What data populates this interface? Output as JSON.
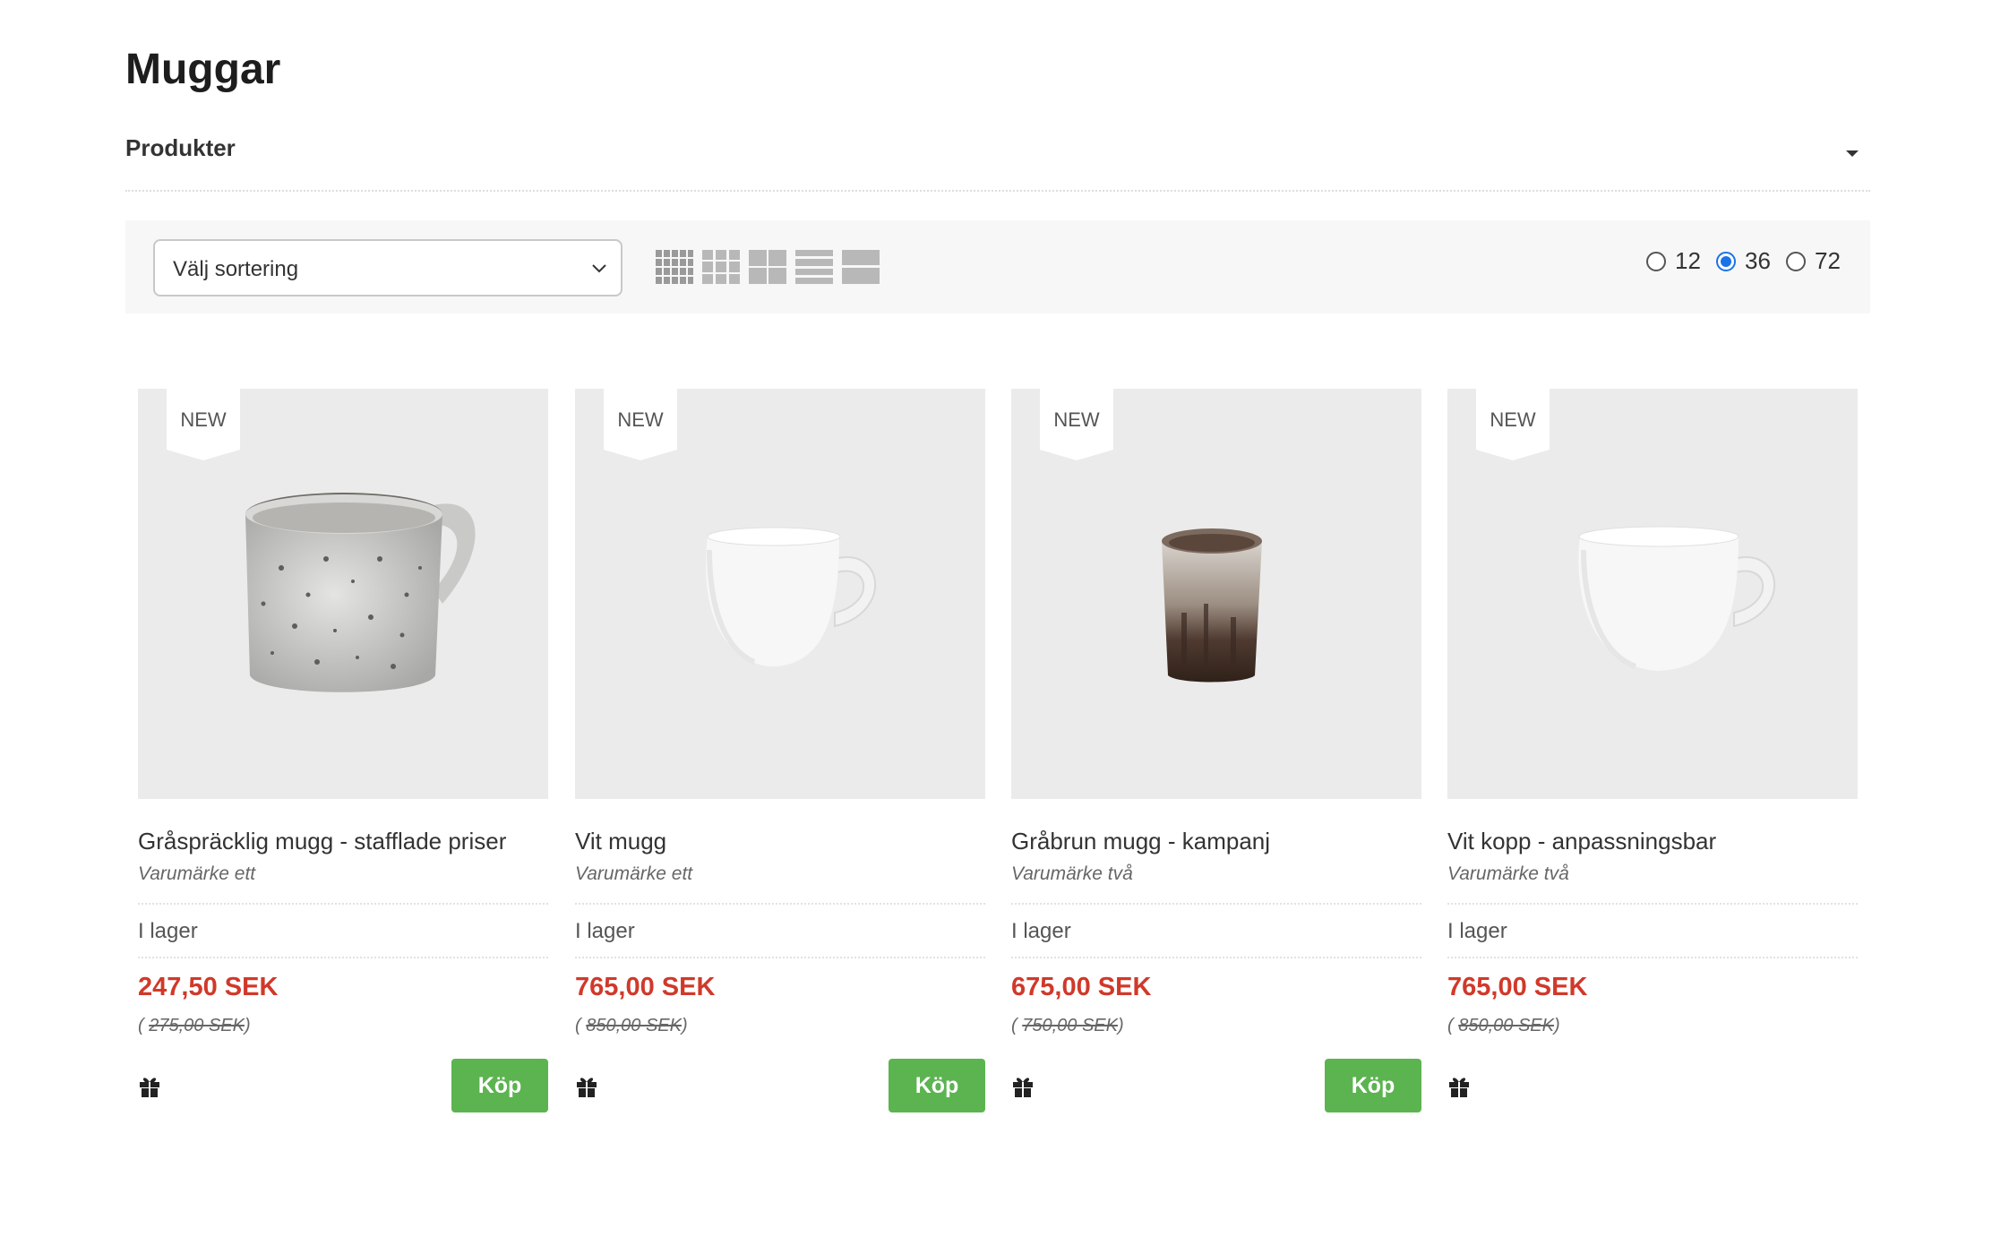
{
  "page": {
    "title": "Muggar"
  },
  "filter": {
    "label": "Produkter"
  },
  "toolbar": {
    "sort_placeholder": "Välj sortering",
    "per_page_options": [
      "12",
      "36",
      "72"
    ],
    "per_page_selected": "36",
    "view_modes": [
      "grid-5-icon",
      "grid-4-icon",
      "grid-3-icon",
      "list-icon",
      "list-large-icon"
    ]
  },
  "products": [
    {
      "badge": "NEW",
      "name": "Gråspräcklig mugg - stafflade priser",
      "brand": "Varumärke ett",
      "stock": "I lager",
      "price": "247,50 SEK",
      "old_price": "275,00 SEK",
      "buy_label": "Köp"
    },
    {
      "badge": "NEW",
      "name": "Vit mugg",
      "brand": "Varumärke ett",
      "stock": "I lager",
      "price": "765,00 SEK",
      "old_price": "850,00 SEK",
      "buy_label": "Köp"
    },
    {
      "badge": "NEW",
      "name": "Gråbrun mugg - kampanj",
      "brand": "Varumärke två",
      "stock": "I lager",
      "price": "675,00 SEK",
      "old_price": "750,00 SEK",
      "buy_label": "Köp"
    },
    {
      "badge": "NEW",
      "name": "Vit kopp - anpassningsbar",
      "brand": "Varumärke två",
      "stock": "I lager",
      "price": "765,00 SEK",
      "old_price": "850,00 SEK"
    }
  ],
  "colors": {
    "price": "#d0392a",
    "buy_button": "#5cb450",
    "radio_selected": "#1a73e8",
    "toolbar_bg": "#f7f7f7",
    "image_bg": "#ebebeb"
  }
}
